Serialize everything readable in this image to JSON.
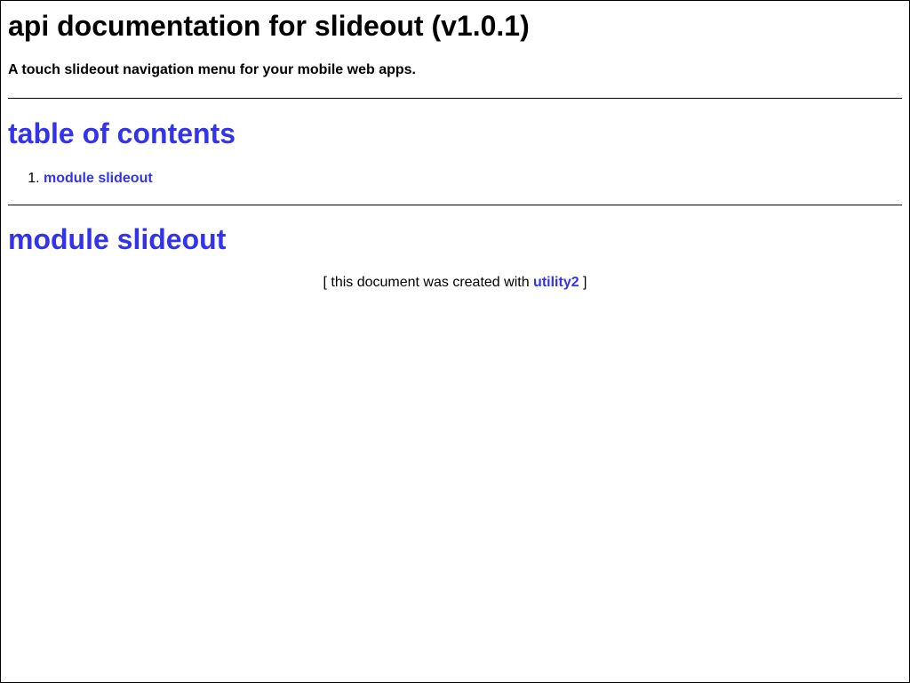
{
  "page": {
    "title": "api documentation for slideout (v1.0.1)",
    "description": "A touch slideout navigation menu for your mobile web apps."
  },
  "toc": {
    "heading": "table of contents",
    "items": [
      {
        "number": "1.",
        "label": "module slideout"
      }
    ]
  },
  "module": {
    "heading": "module slideout"
  },
  "footer": {
    "prefix": "[ this document was created with ",
    "link_label": "utility2",
    "suffix": " ]"
  },
  "colors": {
    "link": "#3333ee",
    "text": "#000000",
    "background": "#ffffff"
  }
}
